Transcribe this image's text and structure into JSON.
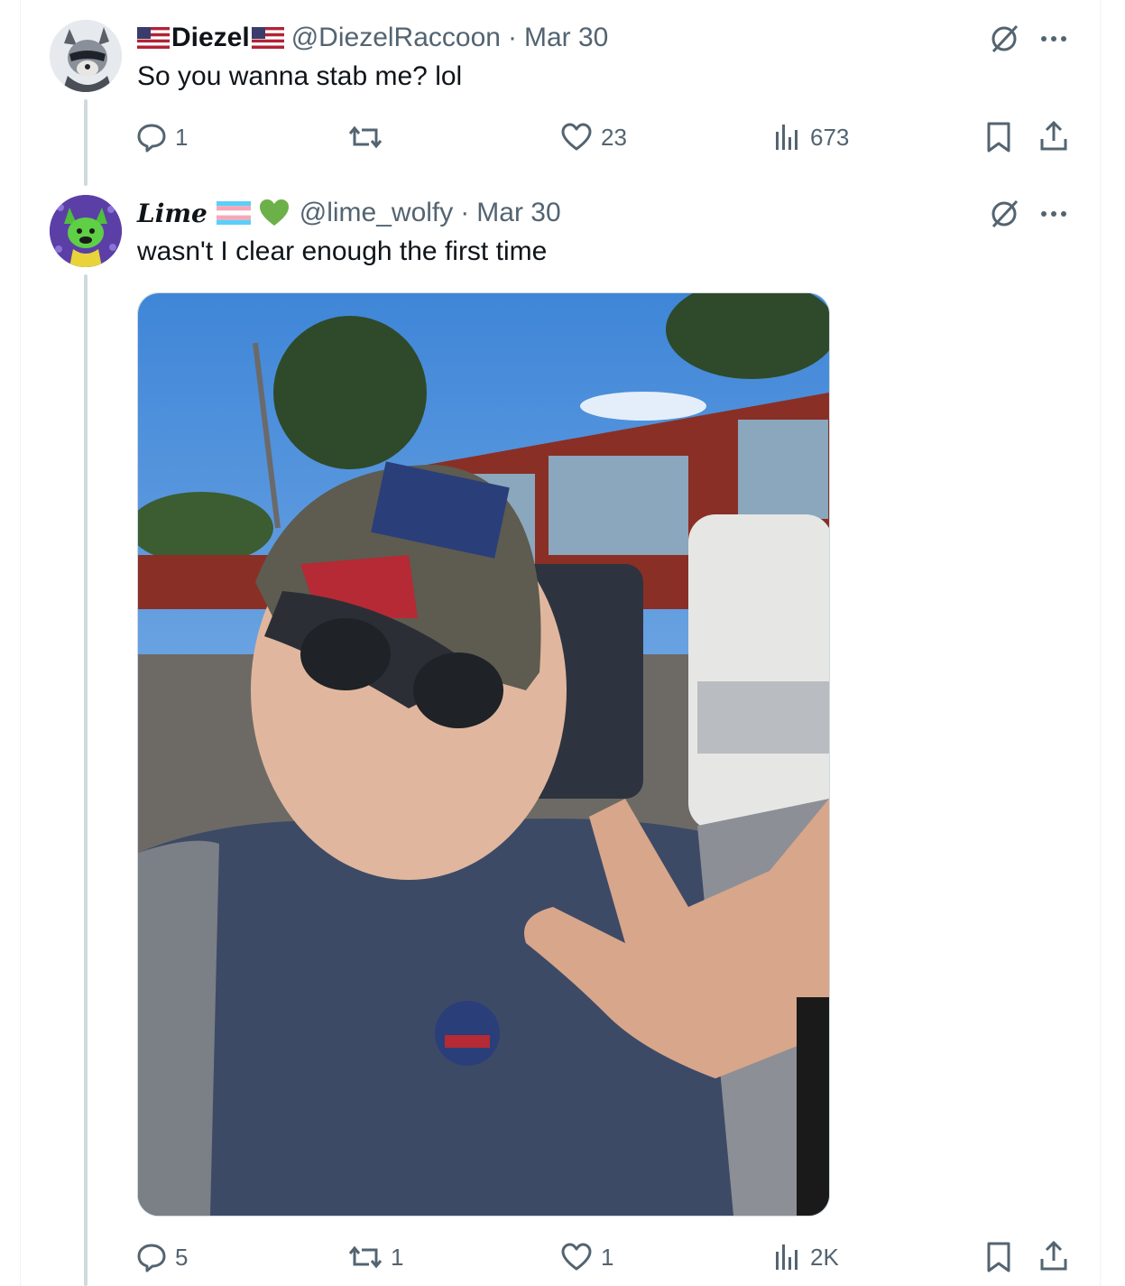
{
  "tweets": [
    {
      "display_name": "Diezel",
      "name_flag": "us-flag-icon",
      "handle": "@DiezelRaccoon",
      "separator": "·",
      "date": "Mar 30",
      "text": "So you wanna stab me? lol",
      "avatar_icon": "raccoon-avatar",
      "actions": {
        "replies": "1",
        "reposts": "",
        "likes": "23",
        "views": "673"
      }
    },
    {
      "display_name": "Lime",
      "name_badges": [
        "trans-flag-icon",
        "green-heart-icon"
      ],
      "handle": "@lime_wolfy",
      "separator": "·",
      "date": "Mar 30",
      "text": "wasn't I clear enough the first time",
      "avatar_icon": "green-wolf-avatar",
      "media_icon": "photo-selfie",
      "actions": {
        "replies": "5",
        "reposts": "1",
        "likes": "1",
        "views": "2K"
      }
    }
  ],
  "colors": {
    "text": "#0f1419",
    "muted": "#536471",
    "thread_line": "#cfd9de",
    "border": "#eff3f4",
    "heart_green": "#6cb04a",
    "trans_blue": "#5bcefa",
    "trans_pink": "#f5a9b8"
  }
}
